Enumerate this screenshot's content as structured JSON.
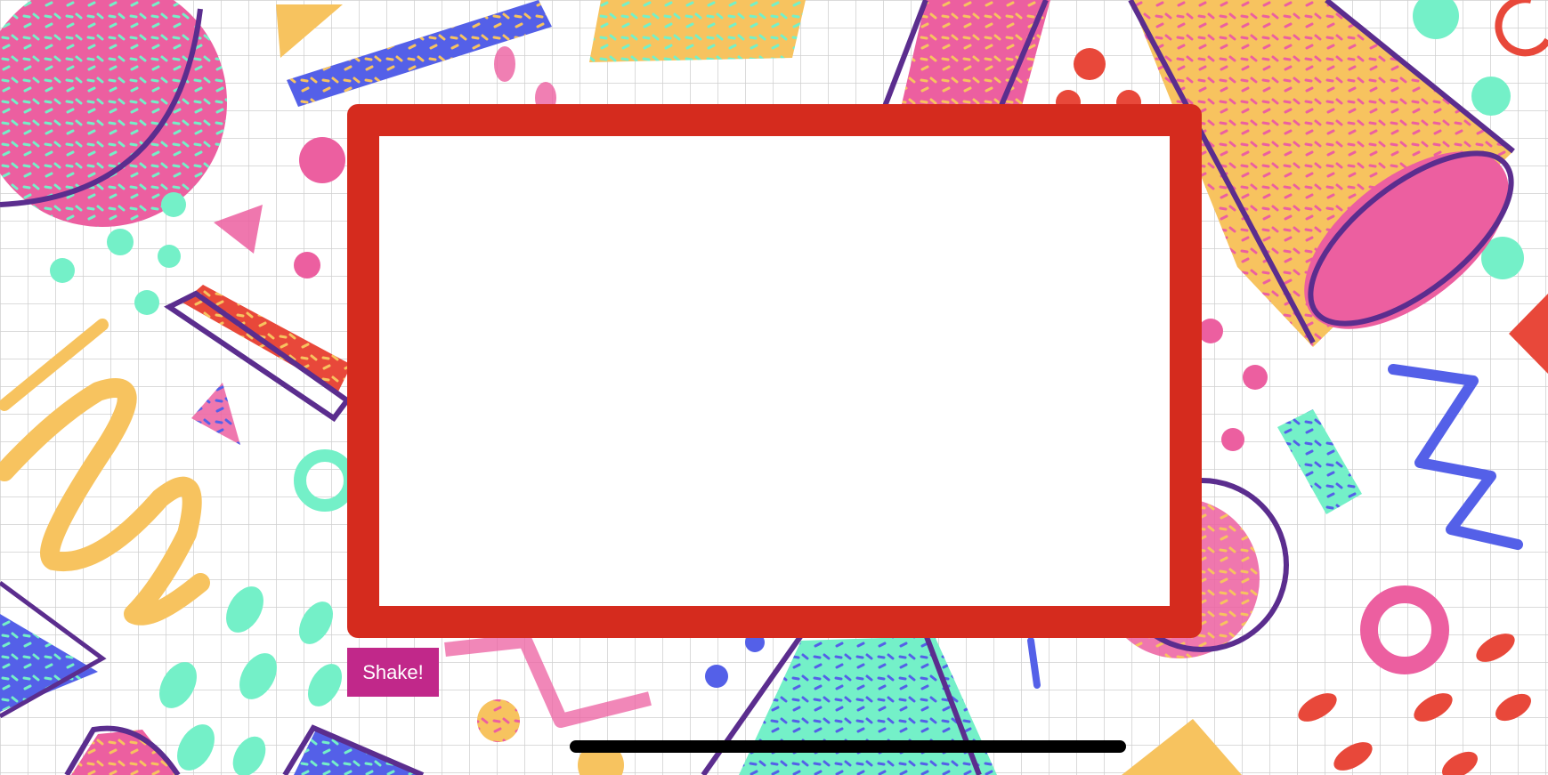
{
  "app": {
    "background": "memphis-pattern-background",
    "colors": {
      "frame": "#d52b1e",
      "button": "#c1288a",
      "pink": "#ec5fa0",
      "yellow": "#f7c35f",
      "mint": "#74f0c8",
      "blue": "#5460e8",
      "purple": "#5b2d8e",
      "red": "#e8483a",
      "grid": "#cfcfcf"
    }
  },
  "controls": {
    "shake_label": "Shake!"
  }
}
